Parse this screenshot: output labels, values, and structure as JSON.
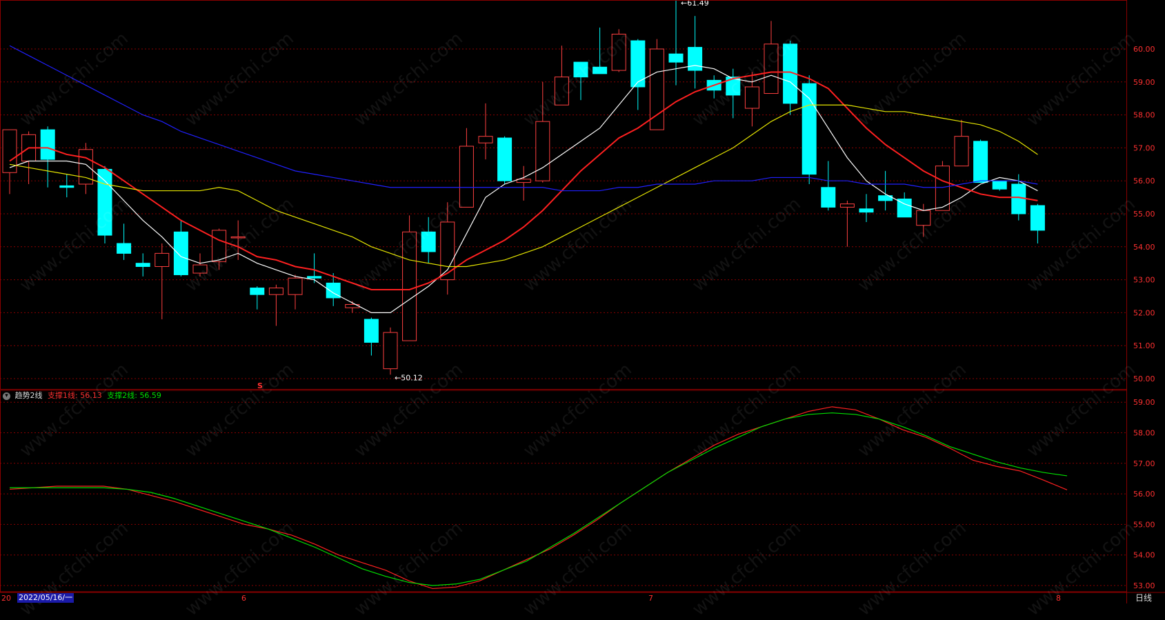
{
  "indicator": {
    "name": "趋势2线",
    "line1_label": "支撑1线:",
    "line1_value": "56.13",
    "line2_label": "支撑2线:",
    "line2_value": "56.59"
  },
  "xaxis": {
    "start_label": "20",
    "month_labels": [
      "6",
      "7",
      "8"
    ],
    "date_label": "2022/05/16/一"
  },
  "period_label": "日线",
  "signal_marker": "S",
  "watermark": "www.cfchi.com",
  "colors": {
    "background": "#000000",
    "border": "#8b0000",
    "grid": "#8b0000",
    "up_candle": "#ff4040",
    "down_candle": "#00ffff",
    "ma5": "#ffffff",
    "ma10": "#ff2020",
    "ma20": "#e6e600",
    "ma60": "#2020ff",
    "support1": "#ff2020",
    "support2": "#00e000",
    "axis_text": "#ff3030"
  },
  "chart_data": [
    {
      "type": "candlestick",
      "ylim": [
        49.8,
        61.8
      ],
      "yticks": [
        50.0,
        51.0,
        52.0,
        53.0,
        54.0,
        55.0,
        56.0,
        57.0,
        58.0,
        59.0,
        60.0
      ],
      "annotations": [
        {
          "label": "61.49",
          "index": 41,
          "value": 61.49
        },
        {
          "label": "50.12",
          "index": 23,
          "value": 50.12
        }
      ],
      "candles": [
        {
          "o": 56.25,
          "h": 56.75,
          "l": 55.6,
          "c": 57.55
        },
        {
          "o": 56.6,
          "h": 57.5,
          "l": 55.9,
          "c": 57.4
        },
        {
          "o": 57.55,
          "h": 57.65,
          "l": 55.8,
          "c": 56.65
        },
        {
          "o": 55.85,
          "h": 56.2,
          "l": 55.5,
          "c": 55.8
        },
        {
          "o": 55.9,
          "h": 57.15,
          "l": 55.6,
          "c": 56.95
        },
        {
          "o": 56.35,
          "h": 56.45,
          "l": 54.1,
          "c": 54.35
        },
        {
          "o": 54.1,
          "h": 54.7,
          "l": 53.6,
          "c": 53.8
        },
        {
          "o": 53.5,
          "h": 53.8,
          "l": 53.1,
          "c": 53.4
        },
        {
          "o": 53.4,
          "h": 54.1,
          "l": 51.8,
          "c": 53.8
        },
        {
          "o": 54.45,
          "h": 54.8,
          "l": 53.1,
          "c": 53.15
        },
        {
          "o": 53.2,
          "h": 53.8,
          "l": 53.1,
          "c": 53.45
        },
        {
          "o": 53.55,
          "h": 54.55,
          "l": 53.3,
          "c": 54.5
        },
        {
          "o": 54.3,
          "h": 54.8,
          "l": 53.6,
          "c": 54.3
        },
        {
          "o": 52.75,
          "h": 52.8,
          "l": 52.1,
          "c": 52.55
        },
        {
          "o": 52.55,
          "h": 52.85,
          "l": 51.6,
          "c": 52.75
        },
        {
          "o": 52.55,
          "h": 53.15,
          "l": 52.1,
          "c": 53.05
        },
        {
          "o": 53.1,
          "h": 53.8,
          "l": 52.9,
          "c": 53.05
        },
        {
          "o": 52.9,
          "h": 53.2,
          "l": 52.2,
          "c": 52.45
        },
        {
          "o": 52.15,
          "h": 52.35,
          "l": 52.0,
          "c": 52.25
        },
        {
          "o": 51.8,
          "h": 51.85,
          "l": 50.7,
          "c": 51.1
        },
        {
          "o": 50.3,
          "h": 51.55,
          "l": 50.12,
          "c": 51.4
        },
        {
          "o": 51.15,
          "h": 54.95,
          "l": 51.15,
          "c": 54.45
        },
        {
          "o": 54.45,
          "h": 54.9,
          "l": 53.5,
          "c": 53.85
        },
        {
          "o": 53.0,
          "h": 55.35,
          "l": 52.55,
          "c": 54.75
        },
        {
          "o": 55.2,
          "h": 57.6,
          "l": 55.2,
          "c": 57.05
        },
        {
          "o": 57.15,
          "h": 58.35,
          "l": 56.65,
          "c": 57.35
        },
        {
          "o": 57.3,
          "h": 57.35,
          "l": 55.9,
          "c": 56.0
        },
        {
          "o": 55.95,
          "h": 56.45,
          "l": 55.4,
          "c": 56.05
        },
        {
          "o": 56.0,
          "h": 59.0,
          "l": 55.95,
          "c": 57.8
        },
        {
          "o": 58.3,
          "h": 60.1,
          "l": 58.3,
          "c": 59.15
        },
        {
          "o": 59.6,
          "h": 59.6,
          "l": 58.45,
          "c": 59.15
        },
        {
          "o": 59.45,
          "h": 60.65,
          "l": 59.25,
          "c": 59.25
        },
        {
          "o": 59.35,
          "h": 60.6,
          "l": 59.3,
          "c": 60.45
        },
        {
          "o": 60.25,
          "h": 60.3,
          "l": 58.15,
          "c": 58.85
        },
        {
          "o": 57.55,
          "h": 60.3,
          "l": 57.55,
          "c": 60.0
        },
        {
          "o": 59.85,
          "h": 61.49,
          "l": 58.9,
          "c": 59.6
        },
        {
          "o": 60.05,
          "h": 61.0,
          "l": 58.8,
          "c": 59.35
        },
        {
          "o": 59.05,
          "h": 59.2,
          "l": 58.5,
          "c": 58.75
        },
        {
          "o": 59.15,
          "h": 59.4,
          "l": 57.9,
          "c": 58.6
        },
        {
          "o": 58.2,
          "h": 59.3,
          "l": 57.65,
          "c": 58.85
        },
        {
          "o": 58.65,
          "h": 60.85,
          "l": 58.65,
          "c": 60.15
        },
        {
          "o": 60.15,
          "h": 60.25,
          "l": 58.0,
          "c": 58.35
        },
        {
          "o": 58.95,
          "h": 59.2,
          "l": 55.9,
          "c": 56.2
        },
        {
          "o": 55.8,
          "h": 56.6,
          "l": 55.1,
          "c": 55.2
        },
        {
          "o": 55.2,
          "h": 55.4,
          "l": 54.0,
          "c": 55.3
        },
        {
          "o": 55.15,
          "h": 55.6,
          "l": 54.75,
          "c": 55.05
        },
        {
          "o": 55.55,
          "h": 56.3,
          "l": 55.1,
          "c": 55.4
        },
        {
          "o": 55.45,
          "h": 55.65,
          "l": 54.9,
          "c": 54.9
        },
        {
          "o": 54.65,
          "h": 55.3,
          "l": 54.3,
          "c": 55.1
        },
        {
          "o": 55.1,
          "h": 56.6,
          "l": 55.1,
          "c": 56.45
        },
        {
          "o": 56.45,
          "h": 57.85,
          "l": 56.45,
          "c": 57.35
        },
        {
          "o": 57.2,
          "h": 57.25,
          "l": 55.95,
          "c": 55.95
        },
        {
          "o": 56.0,
          "h": 56.0,
          "l": 55.7,
          "c": 55.75
        },
        {
          "o": 55.9,
          "h": 56.2,
          "l": 54.8,
          "c": 55.0
        },
        {
          "o": 55.25,
          "h": 55.3,
          "l": 54.1,
          "c": 54.5
        }
      ],
      "series": [
        {
          "key": "ma5",
          "values": [
            56.4,
            56.6,
            56.6,
            56.6,
            56.5,
            56.0,
            55.4,
            54.8,
            54.3,
            53.7,
            53.5,
            53.6,
            53.8,
            53.5,
            53.3,
            53.1,
            53.0,
            52.6,
            52.3,
            52.0,
            52.0,
            52.4,
            52.8,
            53.3,
            54.4,
            55.5,
            55.9,
            56.1,
            56.4,
            56.8,
            57.2,
            57.6,
            58.3,
            59.0,
            59.3,
            59.4,
            59.5,
            59.4,
            59.1,
            59.0,
            59.2,
            59.0,
            58.5,
            57.6,
            56.7,
            56.0,
            55.6,
            55.3,
            55.1,
            55.2,
            55.5,
            55.9,
            56.1,
            56.0,
            55.7
          ]
        },
        {
          "key": "ma10",
          "values": [
            56.6,
            57.0,
            57.0,
            56.8,
            56.7,
            56.4,
            56.0,
            55.6,
            55.2,
            54.8,
            54.5,
            54.2,
            54.0,
            53.7,
            53.6,
            53.4,
            53.3,
            53.1,
            52.9,
            52.7,
            52.7,
            52.7,
            52.9,
            53.2,
            53.6,
            53.9,
            54.2,
            54.6,
            55.1,
            55.7,
            56.3,
            56.8,
            57.3,
            57.6,
            58.0,
            58.4,
            58.7,
            58.9,
            59.1,
            59.2,
            59.3,
            59.3,
            59.1,
            58.8,
            58.2,
            57.6,
            57.1,
            56.7,
            56.3,
            56.0,
            55.8,
            55.6,
            55.5,
            55.5,
            55.4
          ]
        },
        {
          "key": "ma20",
          "values": [
            56.5,
            56.4,
            56.3,
            56.2,
            56.1,
            55.9,
            55.8,
            55.7,
            55.7,
            55.7,
            55.7,
            55.8,
            55.7,
            55.4,
            55.1,
            54.9,
            54.7,
            54.5,
            54.3,
            54.0,
            53.8,
            53.6,
            53.5,
            53.4,
            53.4,
            53.5,
            53.6,
            53.8,
            54.0,
            54.3,
            54.6,
            54.9,
            55.2,
            55.5,
            55.8,
            56.1,
            56.4,
            56.7,
            57.0,
            57.4,
            57.8,
            58.1,
            58.3,
            58.3,
            58.3,
            58.2,
            58.1,
            58.1,
            58.0,
            57.9,
            57.8,
            57.7,
            57.5,
            57.2,
            56.8
          ]
        },
        {
          "key": "ma60",
          "values": [
            60.1,
            59.8,
            59.5,
            59.2,
            58.9,
            58.6,
            58.3,
            58.0,
            57.8,
            57.5,
            57.3,
            57.1,
            56.9,
            56.7,
            56.5,
            56.3,
            56.2,
            56.1,
            56.0,
            55.9,
            55.8,
            55.8,
            55.8,
            55.8,
            55.8,
            55.8,
            55.8,
            55.8,
            55.8,
            55.7,
            55.7,
            55.7,
            55.8,
            55.8,
            55.9,
            55.9,
            55.9,
            56.0,
            56.0,
            56.0,
            56.1,
            56.1,
            56.1,
            56.0,
            56.0,
            55.9,
            55.9,
            55.9,
            55.8,
            55.8,
            55.9,
            56.0,
            56.0,
            56.0,
            55.9
          ]
        }
      ]
    },
    {
      "type": "line",
      "ylim": [
        52.85,
        59.35
      ],
      "yticks": [
        53.0,
        54.0,
        55.0,
        56.0,
        57.0,
        58.0,
        59.0
      ],
      "series": [
        {
          "name": "支撑1线",
          "key": "support1",
          "values": [
            56.15,
            56.2,
            56.25,
            56.25,
            56.25,
            56.15,
            55.95,
            55.75,
            55.5,
            55.25,
            55.0,
            54.85,
            54.65,
            54.35,
            54.0,
            53.75,
            53.5,
            53.15,
            52.9,
            52.95,
            53.15,
            53.5,
            53.85,
            54.2,
            54.65,
            55.15,
            55.7,
            56.2,
            56.7,
            57.15,
            57.6,
            57.95,
            58.2,
            58.45,
            58.7,
            58.85,
            58.75,
            58.45,
            58.1,
            57.85,
            57.5,
            57.1,
            56.9,
            56.75,
            56.45,
            56.13
          ]
        },
        {
          "name": "支撑2线",
          "key": "support2",
          "values": [
            56.2,
            56.2,
            56.2,
            56.2,
            56.2,
            56.15,
            56.05,
            55.85,
            55.6,
            55.35,
            55.1,
            54.85,
            54.55,
            54.25,
            53.9,
            53.55,
            53.3,
            53.1,
            53.0,
            53.05,
            53.2,
            53.5,
            53.8,
            54.25,
            54.7,
            55.2,
            55.7,
            56.2,
            56.7,
            57.1,
            57.5,
            57.85,
            58.2,
            58.45,
            58.6,
            58.65,
            58.6,
            58.45,
            58.2,
            57.9,
            57.55,
            57.3,
            57.05,
            56.85,
            56.7,
            56.59
          ]
        }
      ]
    }
  ]
}
